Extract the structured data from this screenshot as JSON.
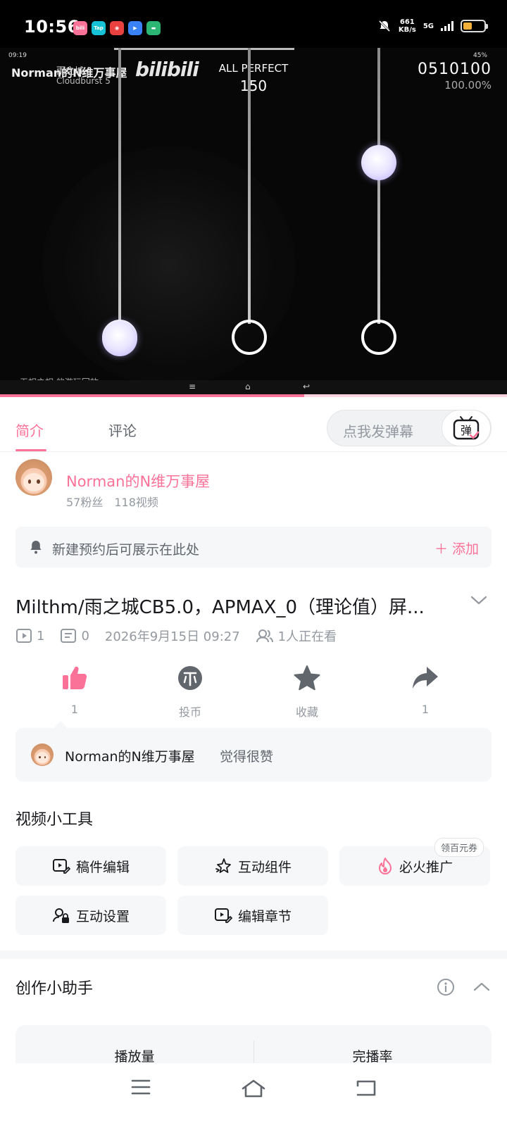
{
  "status_bar": {
    "time": "10:56",
    "net_speed": "661",
    "net_speed_unit": "KB/s",
    "network": "5G",
    "app_icons": [
      "bilibili",
      "Tap",
      "game",
      "play",
      "wallet"
    ]
  },
  "player": {
    "inner_time": "09:19",
    "uploader_overlay": "Norman的N维万事屋",
    "song_title": "雨之城",
    "song_subtitle": "Cloudburst 5",
    "logo": "bilibili",
    "judge": "ALL PERFECT",
    "combo": "150",
    "score": "0510100",
    "accuracy": "100.00%",
    "inner_status": "45%",
    "replay_caption": "无相之相 的游玩回放",
    "progress": 0.6
  },
  "tabs": {
    "intro": "简介",
    "comments": "评论",
    "danmaku_placeholder": "点我发弹幕",
    "danmaku_button": "弹"
  },
  "uploader": {
    "name": "Norman的N维万事屋",
    "fans": "57粉丝",
    "videos": "118视频"
  },
  "reservation": {
    "text": "新建预约后可展示在此处",
    "add_label": "添加"
  },
  "video": {
    "title": "Milthm/雨之城CB5.0，APMAX_0（理论值）屏...",
    "plays": "1",
    "danmaku_count": "0",
    "date": "2026年9月15日 09:27",
    "watching": "1人正在看"
  },
  "actions": {
    "like": "1",
    "coin": "投币",
    "favorite": "收藏",
    "share": "1"
  },
  "liked_by": {
    "name": "Norman的N维万事屋",
    "suffix": "觉得很赞"
  },
  "tools": {
    "title": "视频小工具",
    "items": [
      "稿件编辑",
      "互动组件",
      "必火推广",
      "互动设置",
      "编辑章节"
    ],
    "badge": "领百元券"
  },
  "assistant": {
    "title": "创作小助手",
    "col1": "播放量",
    "col2": "完播率"
  },
  "colors": {
    "accent": "#fb7299",
    "text": "#18191c",
    "muted": "#9499a0",
    "card": "#f6f7f8"
  }
}
